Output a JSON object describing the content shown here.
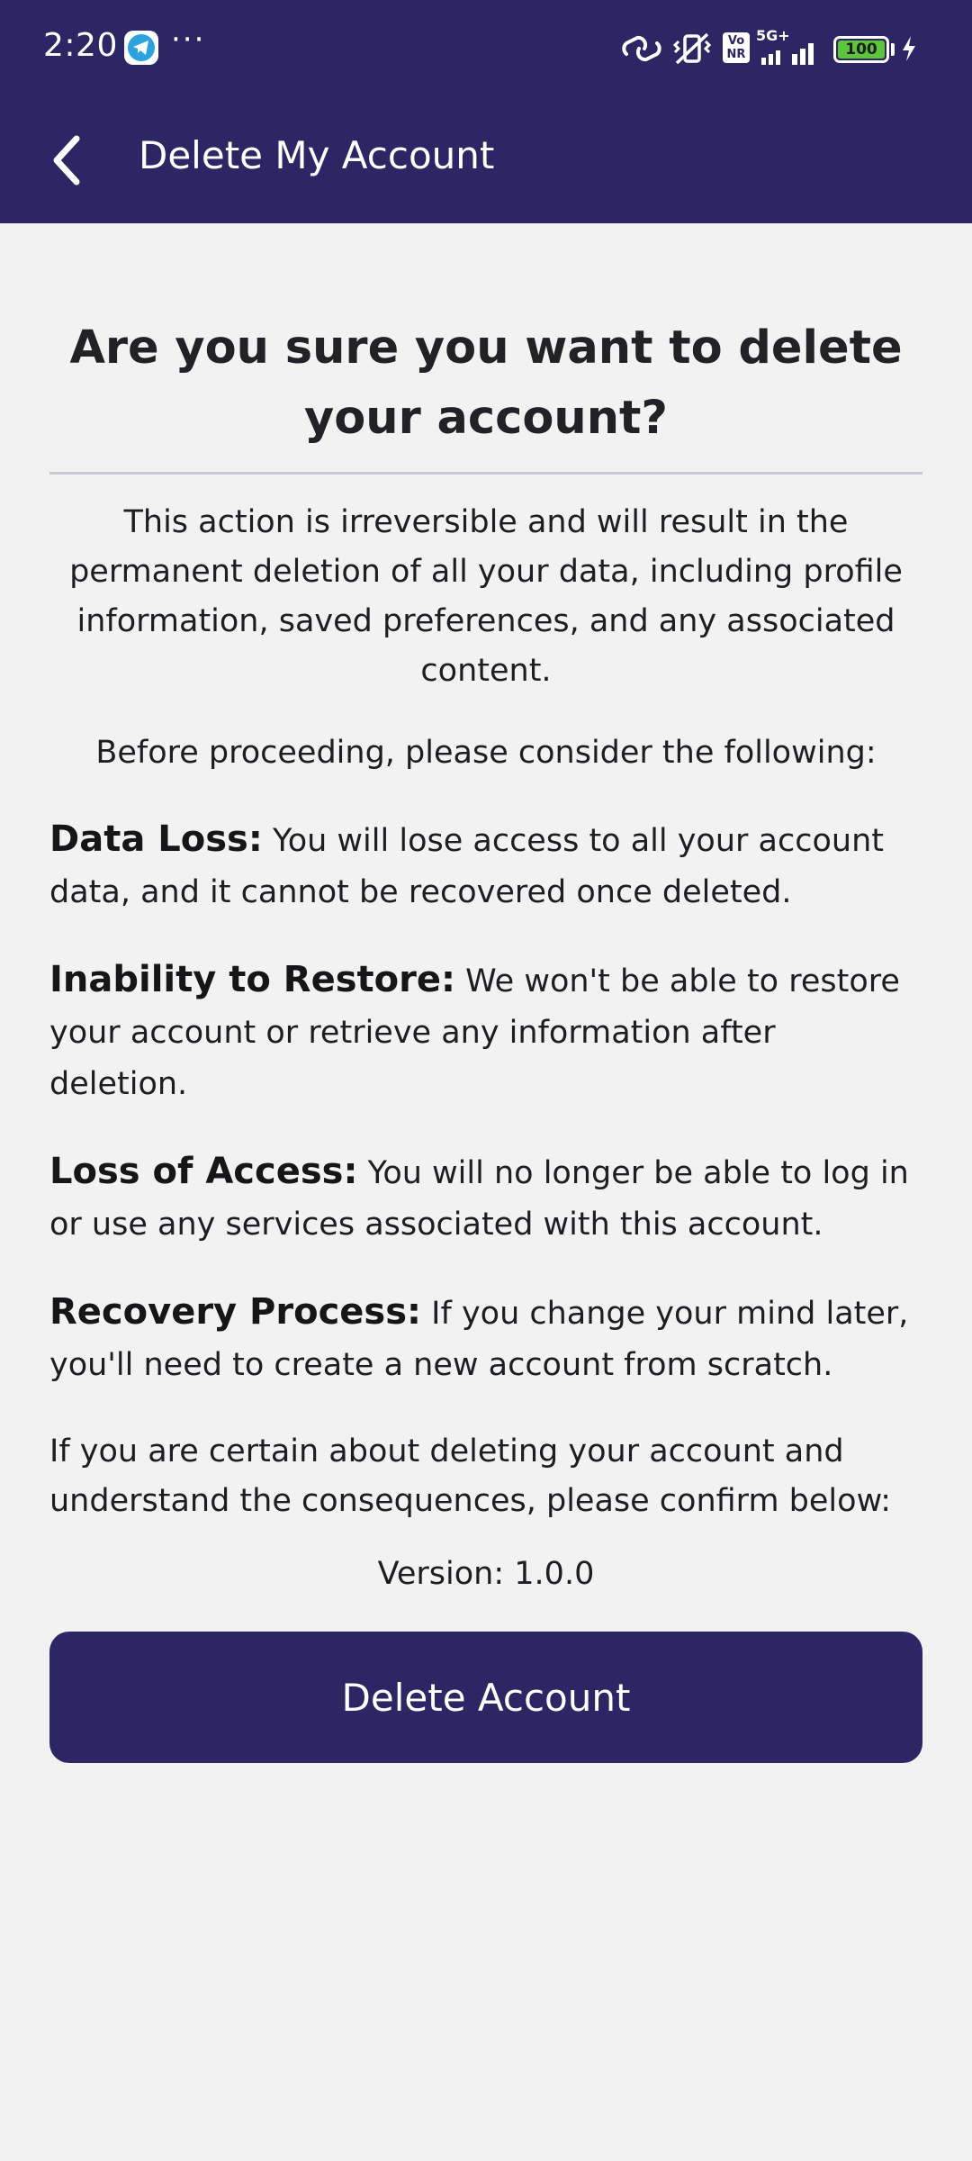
{
  "status_bar": {
    "time": "2:20",
    "more": "···",
    "network": "5G+",
    "volte": "Vo NR",
    "battery": "100"
  },
  "app_bar": {
    "title": "Delete My Account"
  },
  "content": {
    "heading": "Are you sure you want to delete your account?",
    "intro": "This action is irreversible and will result in the permanent deletion of all your data, including profile information, saved preferences, and any associated content.",
    "before": "Before proceeding, please consider the following:",
    "points": [
      {
        "title": "Data Loss:",
        "text": "You will lose access to all your account data, and it cannot be recovered once deleted."
      },
      {
        "title": "Inability to Restore:",
        "text": "We won't be able to restore your account or retrieve any information after deletion."
      },
      {
        "title": "Loss of Access:",
        "text": "You will no longer be able to log in or use any services associated with this account."
      },
      {
        "title": "Recovery Process:",
        "text": "If you change your mind later, you'll need to create a new account from scratch."
      }
    ],
    "confirm": "If you are certain about deleting your account and understand the consequences, please confirm below:",
    "version": "Version: 1.0.0",
    "delete_label": "Delete Account"
  },
  "colors": {
    "primary": "#2c2764",
    "background": "#f2f2f3",
    "battery": "#5cc63a"
  },
  "icons": {
    "back": "chevron-left-icon",
    "telegram": "telegram-icon",
    "link": "link-icon",
    "vibrate": "vibrate-off-icon",
    "signal": "signal-icon"
  }
}
